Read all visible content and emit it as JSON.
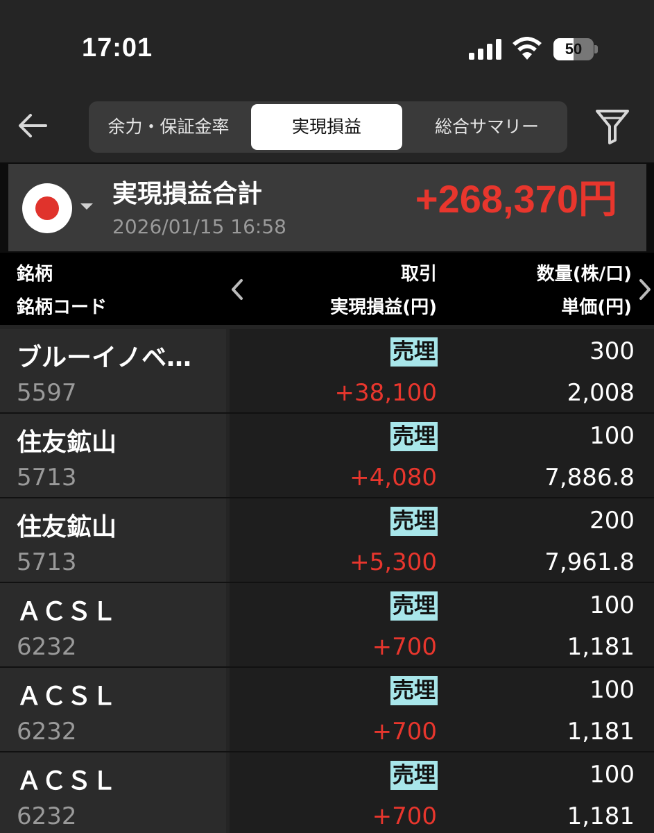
{
  "status_bar": {
    "time": "17:01",
    "battery": "50",
    "battery_level": 0.5
  },
  "nav": {
    "tabs": [
      {
        "label": "余力・保証金率",
        "active": false
      },
      {
        "label": "実現損益",
        "active": true
      },
      {
        "label": "総合サマリー",
        "active": false
      }
    ],
    "back_icon": "arrow-left-icon",
    "filter_icon": "filter-icon"
  },
  "summary": {
    "market_icon": "japan-flag-icon",
    "title": "実現損益合計",
    "timestamp": "2026/01/15 16:58",
    "total": "+268,370円",
    "total_color": "#e8362d"
  },
  "table": {
    "headers": {
      "name": "銘柄",
      "code": "銘柄コード",
      "trade": "取引",
      "pnl": "実現損益(円)",
      "qty": "数量(株/口)",
      "price": "単価(円)"
    },
    "rows": [
      {
        "name": "ブルーイノベ…",
        "code": "5597",
        "trade": "売埋",
        "pnl": "+38,100",
        "qty": "300",
        "price": "2,008"
      },
      {
        "name": "住友鉱山",
        "code": "5713",
        "trade": "売埋",
        "pnl": "+4,080",
        "qty": "100",
        "price": "7,886.8"
      },
      {
        "name": "住友鉱山",
        "code": "5713",
        "trade": "売埋",
        "pnl": "+5,300",
        "qty": "200",
        "price": "7,961.8"
      },
      {
        "name": "ＡＣＳＬ",
        "code": "6232",
        "trade": "売埋",
        "pnl": "+700",
        "qty": "100",
        "price": "1,181"
      },
      {
        "name": "ＡＣＳＬ",
        "code": "6232",
        "trade": "売埋",
        "pnl": "+700",
        "qty": "100",
        "price": "1,181"
      },
      {
        "name": "ＡＣＳＬ",
        "code": "6232",
        "trade": "売埋",
        "pnl": "+700",
        "qty": "100",
        "price": "1,181"
      }
    ]
  },
  "colors": {
    "positive": "#e8362d",
    "badge_bg": "#a8e6ea",
    "background": "#252525"
  }
}
